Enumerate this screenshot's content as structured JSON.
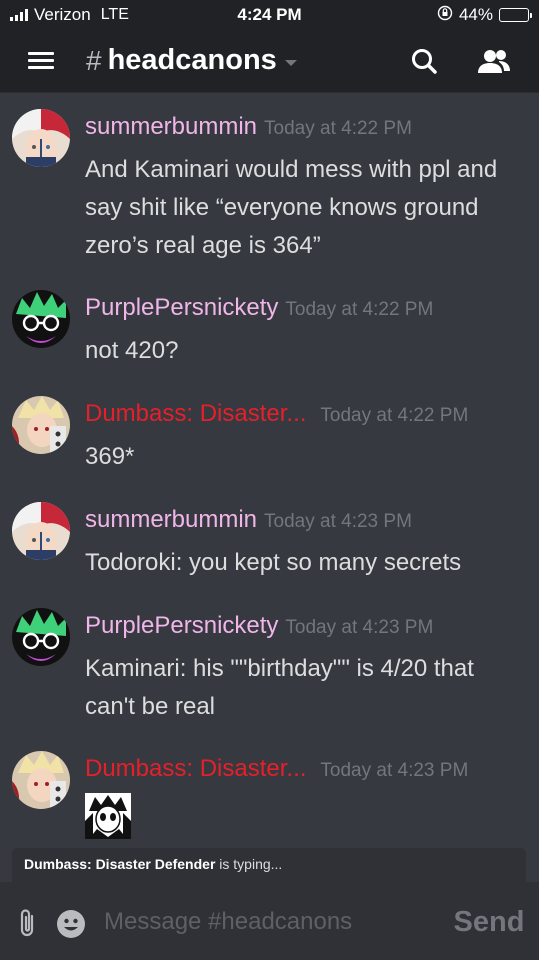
{
  "status_bar": {
    "carrier": "Verizon",
    "network": "LTE",
    "time": "4:24 PM",
    "battery": "44%",
    "battery_level": 0.44
  },
  "header": {
    "hash": "#",
    "channel": "headcanons",
    "icons": [
      "hamburger-menu-icon",
      "caret-down-icon",
      "search-icon",
      "members-icon"
    ]
  },
  "colors": {
    "background": "#36393f",
    "header_bg": "#202225",
    "user_summerbummin": "#f1b6e9",
    "user_purple": "#f1b6e9",
    "user_dumbass": "#e5202a",
    "timestamp": "#72767d"
  },
  "messages": [
    {
      "author": "summerbummin",
      "time": "Today at 4:22 PM",
      "text": "And Kaminari would mess with ppl and say shit like “everyone knows ground zero’s real age is 364”"
    },
    {
      "author": "PurplePersnickety",
      "time": "Today at 4:22 PM",
      "text": "not 420?"
    },
    {
      "author": "Dumbass: Disaster...",
      "time": "Today at 4:22 PM",
      "text": "369*"
    },
    {
      "author": "summerbummin",
      "time": "Today at 4:23 PM",
      "text": "Todoroki: you kept so many secrets"
    },
    {
      "author": "PurplePersnickety",
      "time": "Today at 4:23 PM",
      "text": "Kaminari: his \"\"birthday\"\" is 4/20 that can't be real"
    },
    {
      "author": "Dumbass: Disaster...",
      "time": "Today at 4:23 PM",
      "text": ""
    }
  ],
  "typing": {
    "user": "Dumbass: Disaster Defender",
    "suffix": " is typing..."
  },
  "composer": {
    "placeholder": "Message #headcanons",
    "send_label": "Send"
  }
}
